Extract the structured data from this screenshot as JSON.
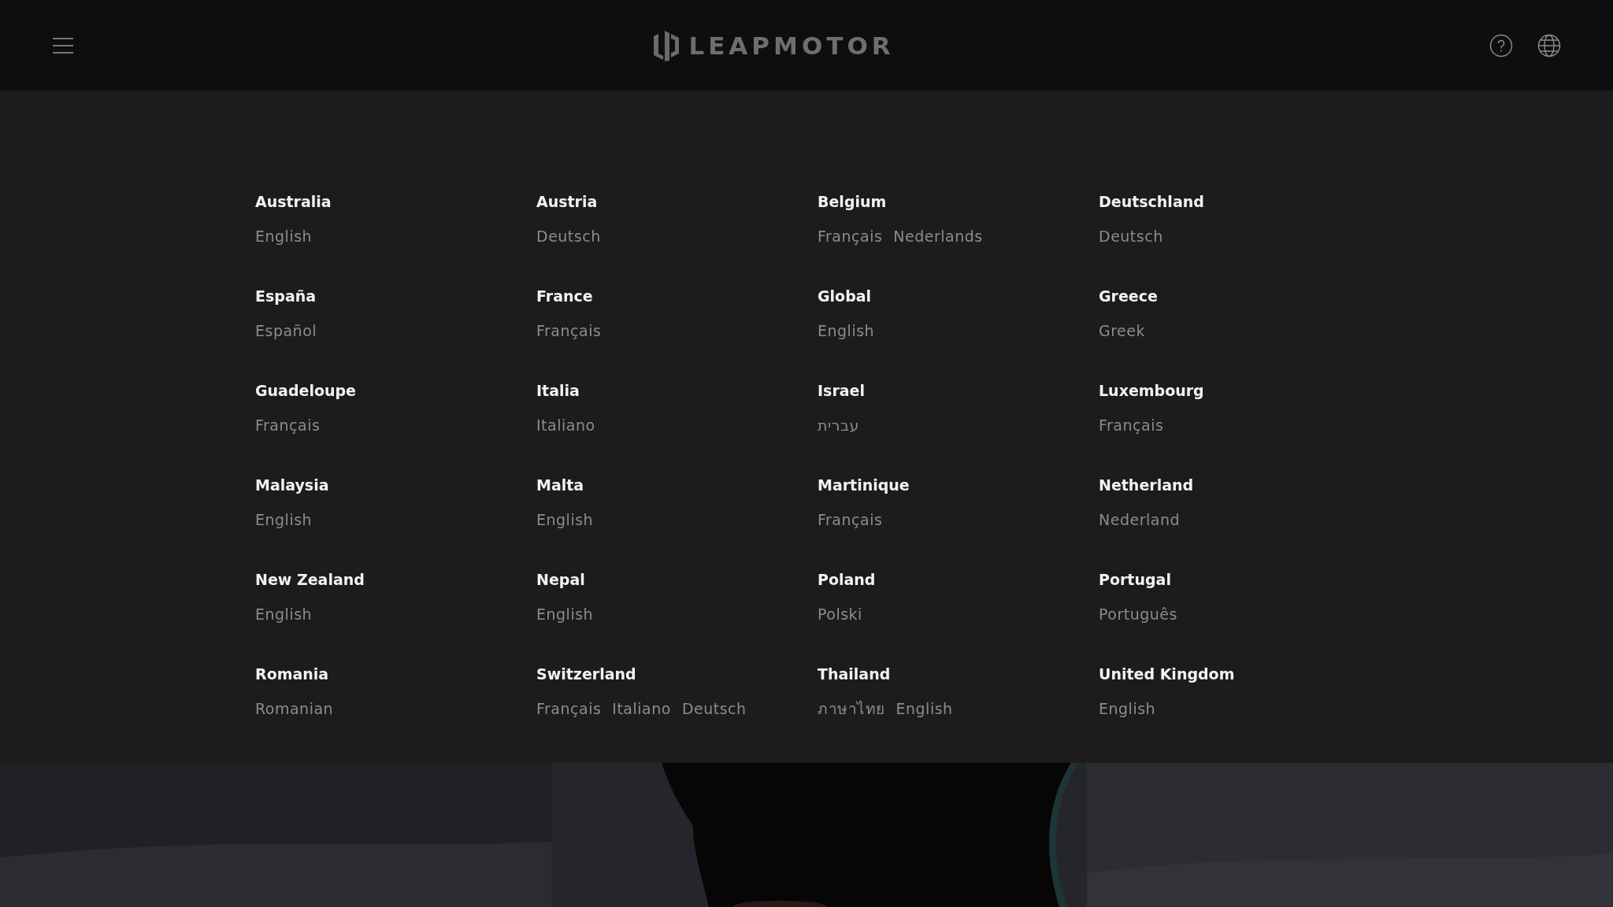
{
  "header": {
    "logo": "LEAPMOTOR"
  },
  "regions": [
    {
      "country": "Australia",
      "languages": [
        "English"
      ]
    },
    {
      "country": "Austria",
      "languages": [
        "Deutsch"
      ]
    },
    {
      "country": "Belgium",
      "languages": [
        "Français",
        "Nederlands"
      ]
    },
    {
      "country": "Deutschland",
      "languages": [
        "Deutsch"
      ]
    },
    {
      "country": "España",
      "languages": [
        "Español"
      ]
    },
    {
      "country": "France",
      "languages": [
        "Français"
      ]
    },
    {
      "country": "Global",
      "languages": [
        "English"
      ]
    },
    {
      "country": "Greece",
      "languages": [
        "Greek"
      ]
    },
    {
      "country": "Guadeloupe",
      "languages": [
        "Français"
      ]
    },
    {
      "country": "Italia",
      "languages": [
        "Italiano"
      ]
    },
    {
      "country": "Israel",
      "languages": [
        "עברית"
      ]
    },
    {
      "country": "Luxembourg",
      "languages": [
        "Français"
      ]
    },
    {
      "country": "Malaysia",
      "languages": [
        "English"
      ]
    },
    {
      "country": "Malta",
      "languages": [
        "English"
      ]
    },
    {
      "country": "Martinique",
      "languages": [
        "Français"
      ]
    },
    {
      "country": "Netherland",
      "languages": [
        "Nederland"
      ]
    },
    {
      "country": "New Zealand",
      "languages": [
        "English"
      ]
    },
    {
      "country": "Nepal",
      "languages": [
        "English"
      ]
    },
    {
      "country": "Poland",
      "languages": [
        "Polski"
      ]
    },
    {
      "country": "Portugal",
      "languages": [
        "Português"
      ]
    },
    {
      "country": "Romania",
      "languages": [
        "Romanian"
      ]
    },
    {
      "country": "Switzerland",
      "languages": [
        "Français",
        "Italiano",
        "Deutsch"
      ]
    },
    {
      "country": "Thailand",
      "languages": [
        "ภาษาไทย",
        "English"
      ]
    },
    {
      "country": "United Kingdom",
      "languages": [
        "English"
      ]
    }
  ]
}
